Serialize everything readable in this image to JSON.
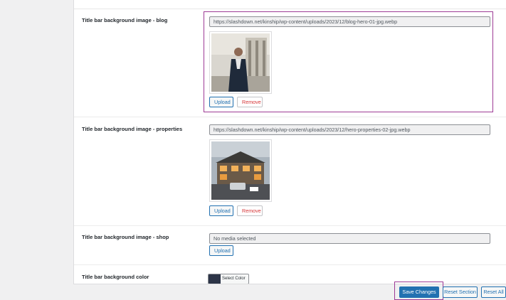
{
  "fields": {
    "blog": {
      "label": "Title bar background image - blog",
      "url": "https://slashdown.net/kinship/wp-content/uploads/2023/12/blog-hero-01-jpg.webp",
      "upload_label": "Upload",
      "remove_label": "Remove"
    },
    "properties": {
      "label": "Title bar background image - properties",
      "url": "https://slashdown.net/kinship/wp-content/uploads/2023/12/hero-properties-02-jpg.webp",
      "upload_label": "Upload",
      "remove_label": "Remove"
    },
    "shop": {
      "label": "Title bar background image - shop",
      "placeholder": "No media selected",
      "upload_label": "Upload"
    },
    "color": {
      "label": "Title bar background color",
      "select_label": "Select Color",
      "value": "#2c3447"
    }
  },
  "footer": {
    "save_label": "Save Changes",
    "reset_section_label": "Reset Section",
    "reset_all_label": "Reset All"
  },
  "colors": {
    "accent": "#2271b1",
    "highlight": "#9d3a95",
    "remove": "#d63638"
  }
}
